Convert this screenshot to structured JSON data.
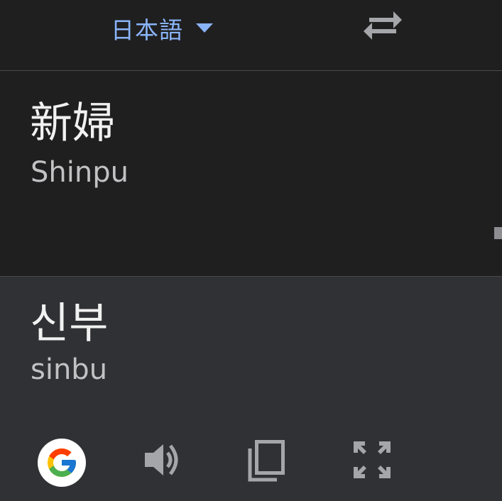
{
  "header": {
    "source_language": "日本語",
    "icons": {
      "caret": "caret-down-icon",
      "swap": "swap-languages-icon"
    }
  },
  "source": {
    "text": "新婦",
    "transliteration": "Shinpu"
  },
  "target": {
    "text": "신부",
    "transliteration": "sinbu"
  },
  "toolbar": {
    "icons": [
      "google-logo-icon",
      "speaker-icon",
      "copy-icon",
      "expand-icon"
    ]
  },
  "colors": {
    "background": "#1f1f20",
    "target_background": "#303134",
    "accent": "#8ab4f8",
    "icon_gray": "#a5a6a9",
    "divider": "#4a4a4c"
  }
}
